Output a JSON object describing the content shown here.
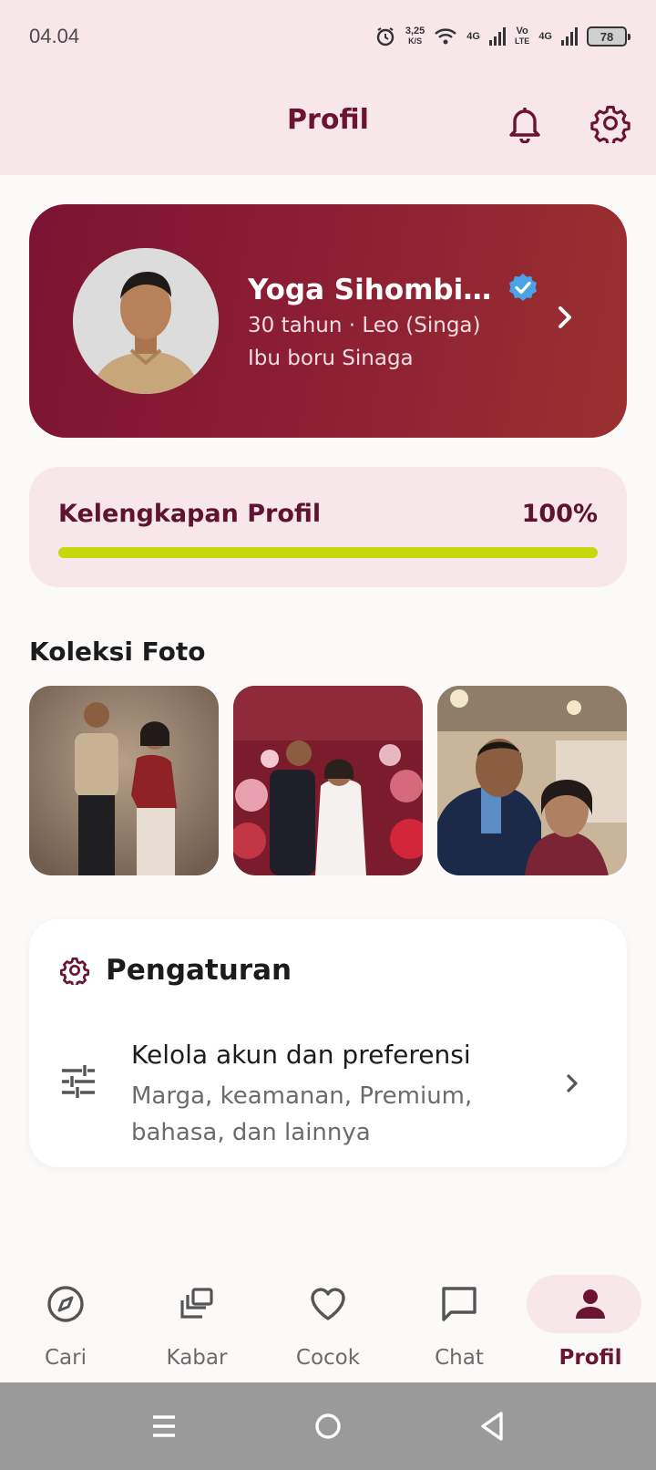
{
  "status_bar": {
    "time": "04.04",
    "net_speed": "3,25",
    "net_unit": "K/S",
    "net_type_1": "4G",
    "volte_top": "Vo",
    "volte_bottom": "LTE",
    "net_type_2": "4G",
    "battery": "78"
  },
  "app_bar": {
    "title": "Profil",
    "icons": [
      "bell-icon",
      "gear-icon"
    ]
  },
  "profile": {
    "name": "Yoga Sihombi...",
    "age_zodiac": "30 tahun · Leo (Singa)",
    "mother": "Ibu boru Sinaga",
    "verified": true,
    "gradient_start": "#7d1333",
    "gradient_end": "#9a3030"
  },
  "completion": {
    "label": "Kelengkapan Profil",
    "value_text": "100%",
    "value": 1.0,
    "bar_color": "#c6d80c"
  },
  "gallery": {
    "title": "Koleksi Foto",
    "photos": [
      "photo-1",
      "photo-2",
      "photo-3"
    ]
  },
  "settings": {
    "title": "Pengaturan",
    "row_title": "Kelola akun dan preferensi",
    "row_desc": "Marga, keamanan, Premium, bahasa, dan lainnya"
  },
  "bottom_nav": {
    "items": [
      {
        "label": "Cari",
        "icon": "compass-icon"
      },
      {
        "label": "Kabar",
        "icon": "stack-icon"
      },
      {
        "label": "Cocok",
        "icon": "heart-icon"
      },
      {
        "label": "Chat",
        "icon": "chat-icon"
      },
      {
        "label": "Profil",
        "icon": "person-icon",
        "active": true
      }
    ]
  },
  "colors": {
    "accent": "#6b1431",
    "header_bg": "#f7e6ea"
  }
}
